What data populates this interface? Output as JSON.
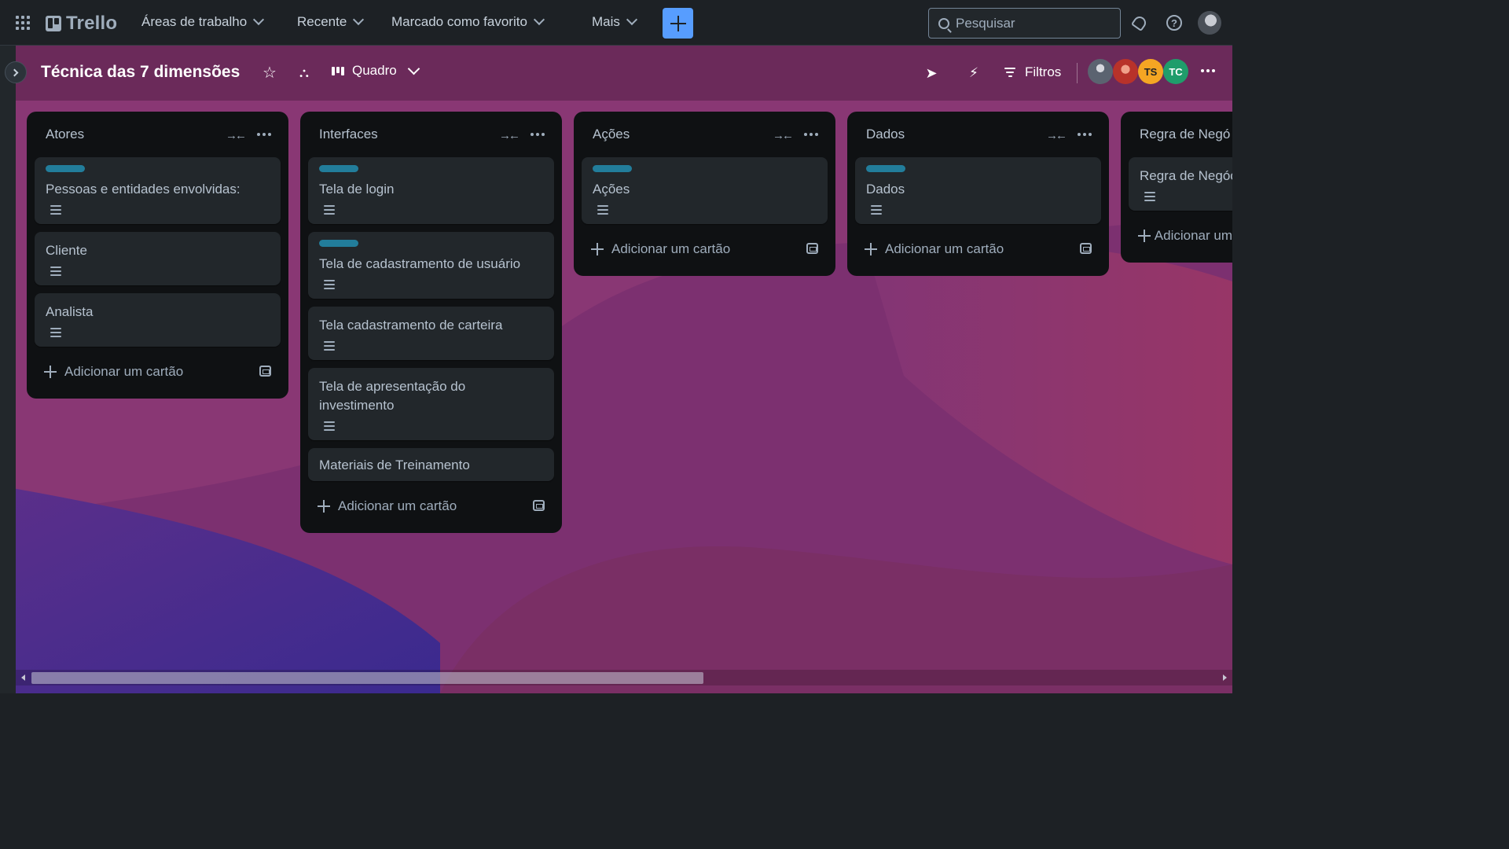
{
  "app": {
    "name": "Trello",
    "nav": [
      {
        "label": "Áreas de trabalho"
      },
      {
        "label": "Recente"
      },
      {
        "label": "Marcado como favorito"
      },
      {
        "label": "Mais"
      }
    ],
    "search_placeholder": "Pesquisar"
  },
  "board": {
    "title": "Técnica das 7 dimensões",
    "view_label": "Quadro",
    "filter_label": "Filtros",
    "members": [
      {
        "initials": "",
        "color": "#6b7480"
      },
      {
        "initials": "",
        "color": "#c0392b"
      },
      {
        "initials": "TS",
        "color": "#f5a623"
      },
      {
        "initials": "TC",
        "color": "#1f9d6b"
      }
    ],
    "lists": [
      {
        "title": "Atores",
        "cards": [
          {
            "title": "Pessoas e entidades envolvidas:",
            "label": true,
            "description": true
          },
          {
            "title": "Cliente",
            "label": false,
            "description": true
          },
          {
            "title": "Analista",
            "label": false,
            "description": true
          }
        ],
        "add_label": "Adicionar um cartão"
      },
      {
        "title": "Interfaces",
        "cards": [
          {
            "title": "Tela de login",
            "label": true,
            "description": true
          },
          {
            "title": "Tela de cadastramento de usuário",
            "label": true,
            "description": true
          },
          {
            "title": "Tela cadastramento de carteira",
            "label": false,
            "description": true
          },
          {
            "title": "Tela de apresentação do investimento",
            "label": false,
            "description": true
          },
          {
            "title": "Materiais de Treinamento",
            "label": false,
            "description": false
          }
        ],
        "add_label": "Adicionar um cartão"
      },
      {
        "title": "Ações",
        "cards": [
          {
            "title": "Ações",
            "label": true,
            "description": true
          }
        ],
        "add_label": "Adicionar um cartão"
      },
      {
        "title": "Dados",
        "cards": [
          {
            "title": "Dados",
            "label": true,
            "description": true
          }
        ],
        "add_label": "Adicionar um cartão"
      },
      {
        "title": "Regra de Negó",
        "cards": [
          {
            "title": "Regra de Negóc",
            "label": false,
            "description": true
          }
        ],
        "add_label": "Adicionar um"
      }
    ]
  },
  "colors": {
    "accent": "#579dff",
    "label": "#227d9b",
    "list_bg": "#0f1113",
    "card_bg": "#22272b"
  }
}
